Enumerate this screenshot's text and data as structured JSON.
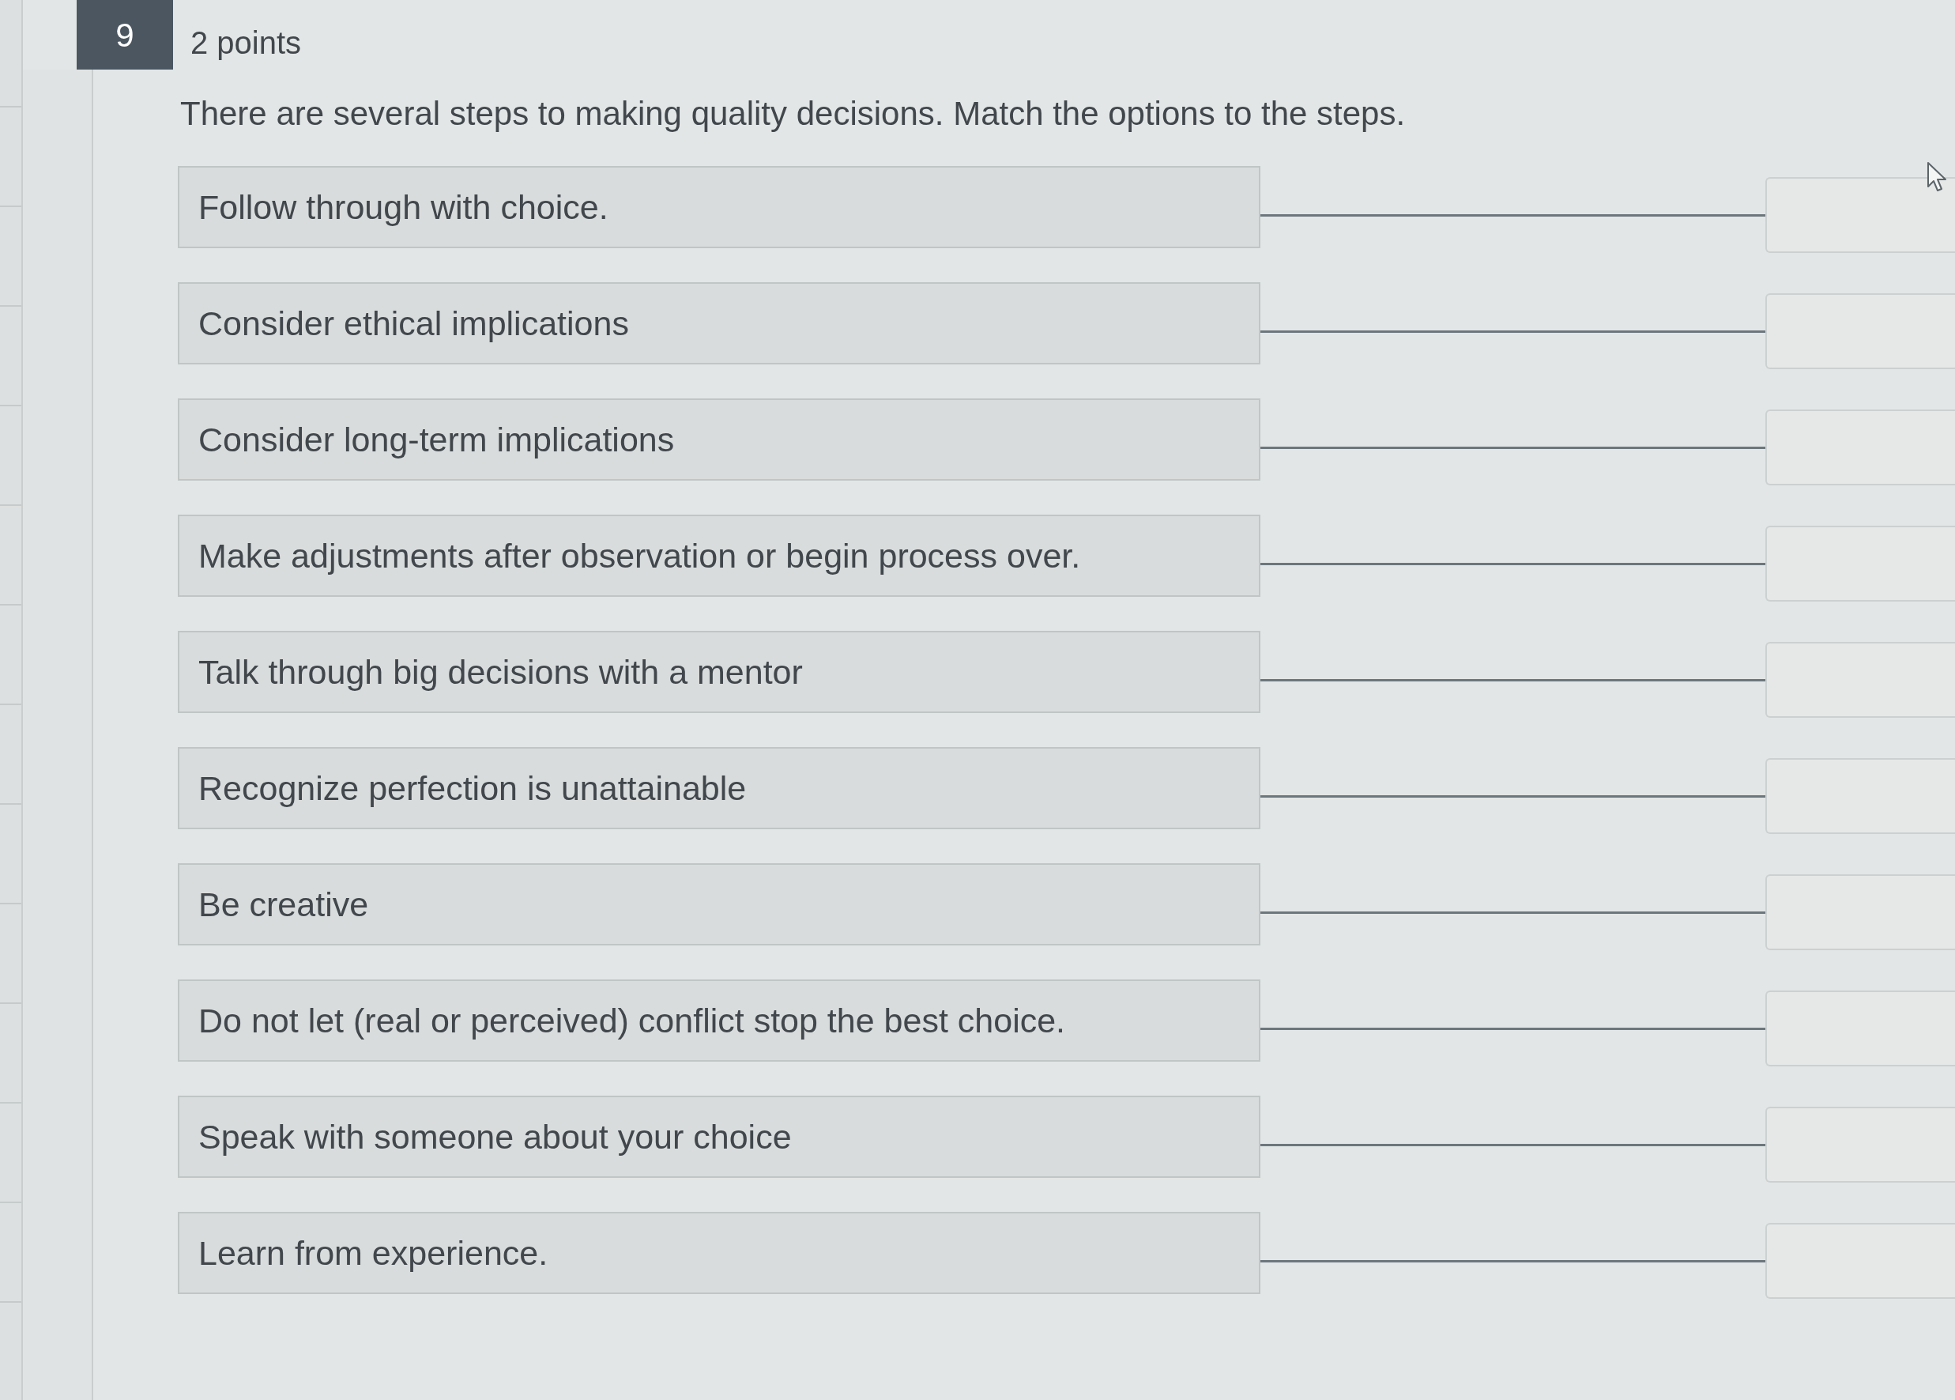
{
  "question": {
    "number": "9",
    "points": "2 points",
    "prompt": "There are several steps to making quality decisions. Match the options to the steps.",
    "options": [
      "Follow through with choice.",
      "Consider ethical implications",
      "Consider long-term implications",
      "Make adjustments after observation or begin process over.",
      "Talk through big decisions with a mentor",
      "Recognize perfection is unattainable",
      "Be creative",
      "Do not let (real or perceived) conflict stop the best choice.",
      "Speak with someone about your choice",
      "Learn from experience."
    ]
  }
}
